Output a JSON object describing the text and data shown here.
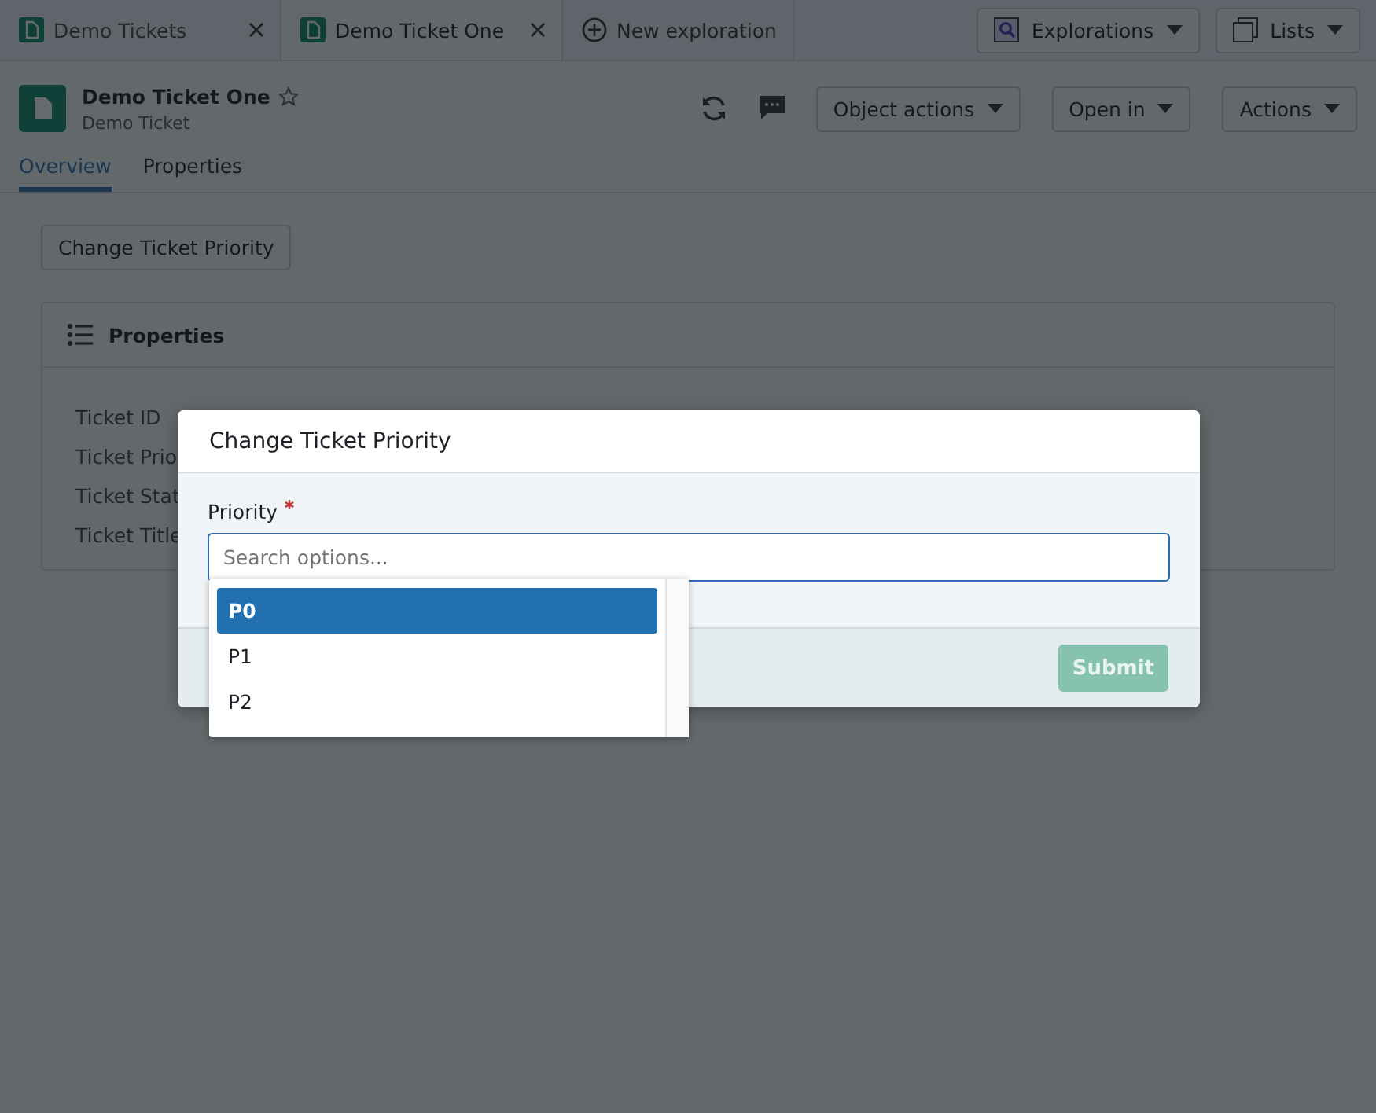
{
  "tabs": [
    {
      "label": "Demo Tickets",
      "selected": false
    },
    {
      "label": "Demo Ticket One",
      "selected": true
    }
  ],
  "new_tab": {
    "label": "New exploration"
  },
  "top_buttons": [
    {
      "label": "Explorations",
      "kind": "explorations"
    },
    {
      "label": "Lists",
      "kind": "lists"
    }
  ],
  "object": {
    "title": "Demo Ticket One",
    "subtitle": "Demo Ticket",
    "starred": false
  },
  "header_buttons": [
    "Object actions",
    "Open in",
    "Actions"
  ],
  "view_tabs": [
    {
      "label": "Overview",
      "selected": true
    },
    {
      "label": "Properties",
      "selected": false
    }
  ],
  "action_button": "Change Ticket Priority",
  "properties_card": {
    "title": "Properties",
    "rows": [
      "Ticket ID",
      "Ticket Prio",
      "Ticket Stat",
      "Ticket Title"
    ]
  },
  "dialog": {
    "title": "Change Ticket Priority",
    "field_label": "Priority",
    "required": true,
    "placeholder": "Search options...",
    "options": [
      {
        "label": "P0",
        "selected": true
      },
      {
        "label": "P1",
        "selected": false
      },
      {
        "label": "P2",
        "selected": false
      }
    ],
    "submit": {
      "label": "Submit",
      "disabled": true
    }
  }
}
